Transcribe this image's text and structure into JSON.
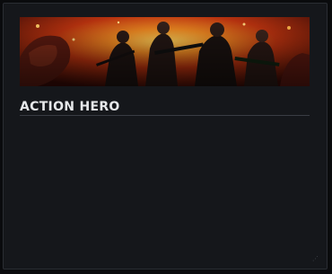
{
  "card": {
    "title": "ACTION HERO",
    "banner_image": "action-hero-artwork",
    "corner_icon": "resize-grip-icon"
  },
  "colors": {
    "background": "#0a0b0d",
    "card": "#15171b",
    "title": "#e6e8ea",
    "divider": "#3a3d44",
    "banner_fire": "#e8601a"
  }
}
